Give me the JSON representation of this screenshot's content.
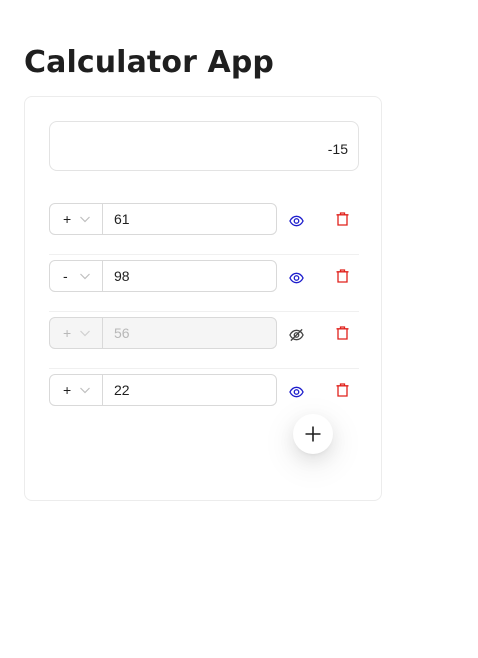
{
  "page": {
    "title": "Calculator App"
  },
  "calculator": {
    "result": "-15",
    "rows": [
      {
        "operator": "+",
        "value": "61",
        "visible": true,
        "disabled": false
      },
      {
        "operator": "-",
        "value": "98",
        "visible": true,
        "disabled": false
      },
      {
        "operator": "+",
        "value": "56",
        "visible": false,
        "disabled": true
      },
      {
        "operator": "+",
        "value": "22",
        "visible": true,
        "disabled": false
      }
    ],
    "icons": {
      "visible": "eye-icon",
      "hidden": "eye-invisible-icon",
      "delete": "trash-icon",
      "dropdown": "chevron-down-icon",
      "add": "plus-icon"
    }
  },
  "colors": {
    "eye_visible": "#1d1dcc",
    "eye_hidden": "#444444",
    "delete": "#e0201b",
    "text": "#1f1f1f",
    "disabled_text": "#b8b8b8"
  }
}
